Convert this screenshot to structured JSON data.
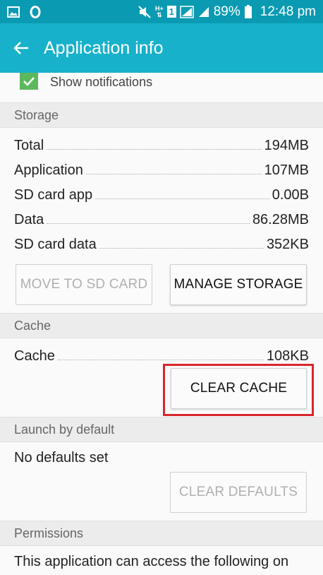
{
  "status_bar": {
    "battery": "89%",
    "time": "12:48 pm",
    "sim_badge": "1",
    "network_label": "H+"
  },
  "app_bar": {
    "title": "Application info"
  },
  "notifications": {
    "label": "Show notifications",
    "checked": true
  },
  "storage": {
    "header": "Storage",
    "rows": [
      {
        "label": "Total",
        "value": "194MB"
      },
      {
        "label": "Application",
        "value": "107MB"
      },
      {
        "label": "SD card app",
        "value": "0.00B"
      },
      {
        "label": "Data",
        "value": "86.28MB"
      },
      {
        "label": "SD card data",
        "value": "352KB"
      }
    ],
    "move_button": "MOVE TO SD CARD",
    "manage_button": "MANAGE STORAGE"
  },
  "cache": {
    "header": "Cache",
    "label": "Cache",
    "value": "108KB",
    "clear_button": "CLEAR CACHE"
  },
  "launch": {
    "header": "Launch by default",
    "text": "No defaults set",
    "clear_button": "CLEAR DEFAULTS"
  },
  "permissions": {
    "header": "Permissions",
    "text": "This application can access the following on"
  },
  "colors": {
    "status_bar": "#0a9ab2",
    "app_bar": "#17b1cb",
    "checkbox": "#5cb85c",
    "highlight": "#d9262c"
  }
}
